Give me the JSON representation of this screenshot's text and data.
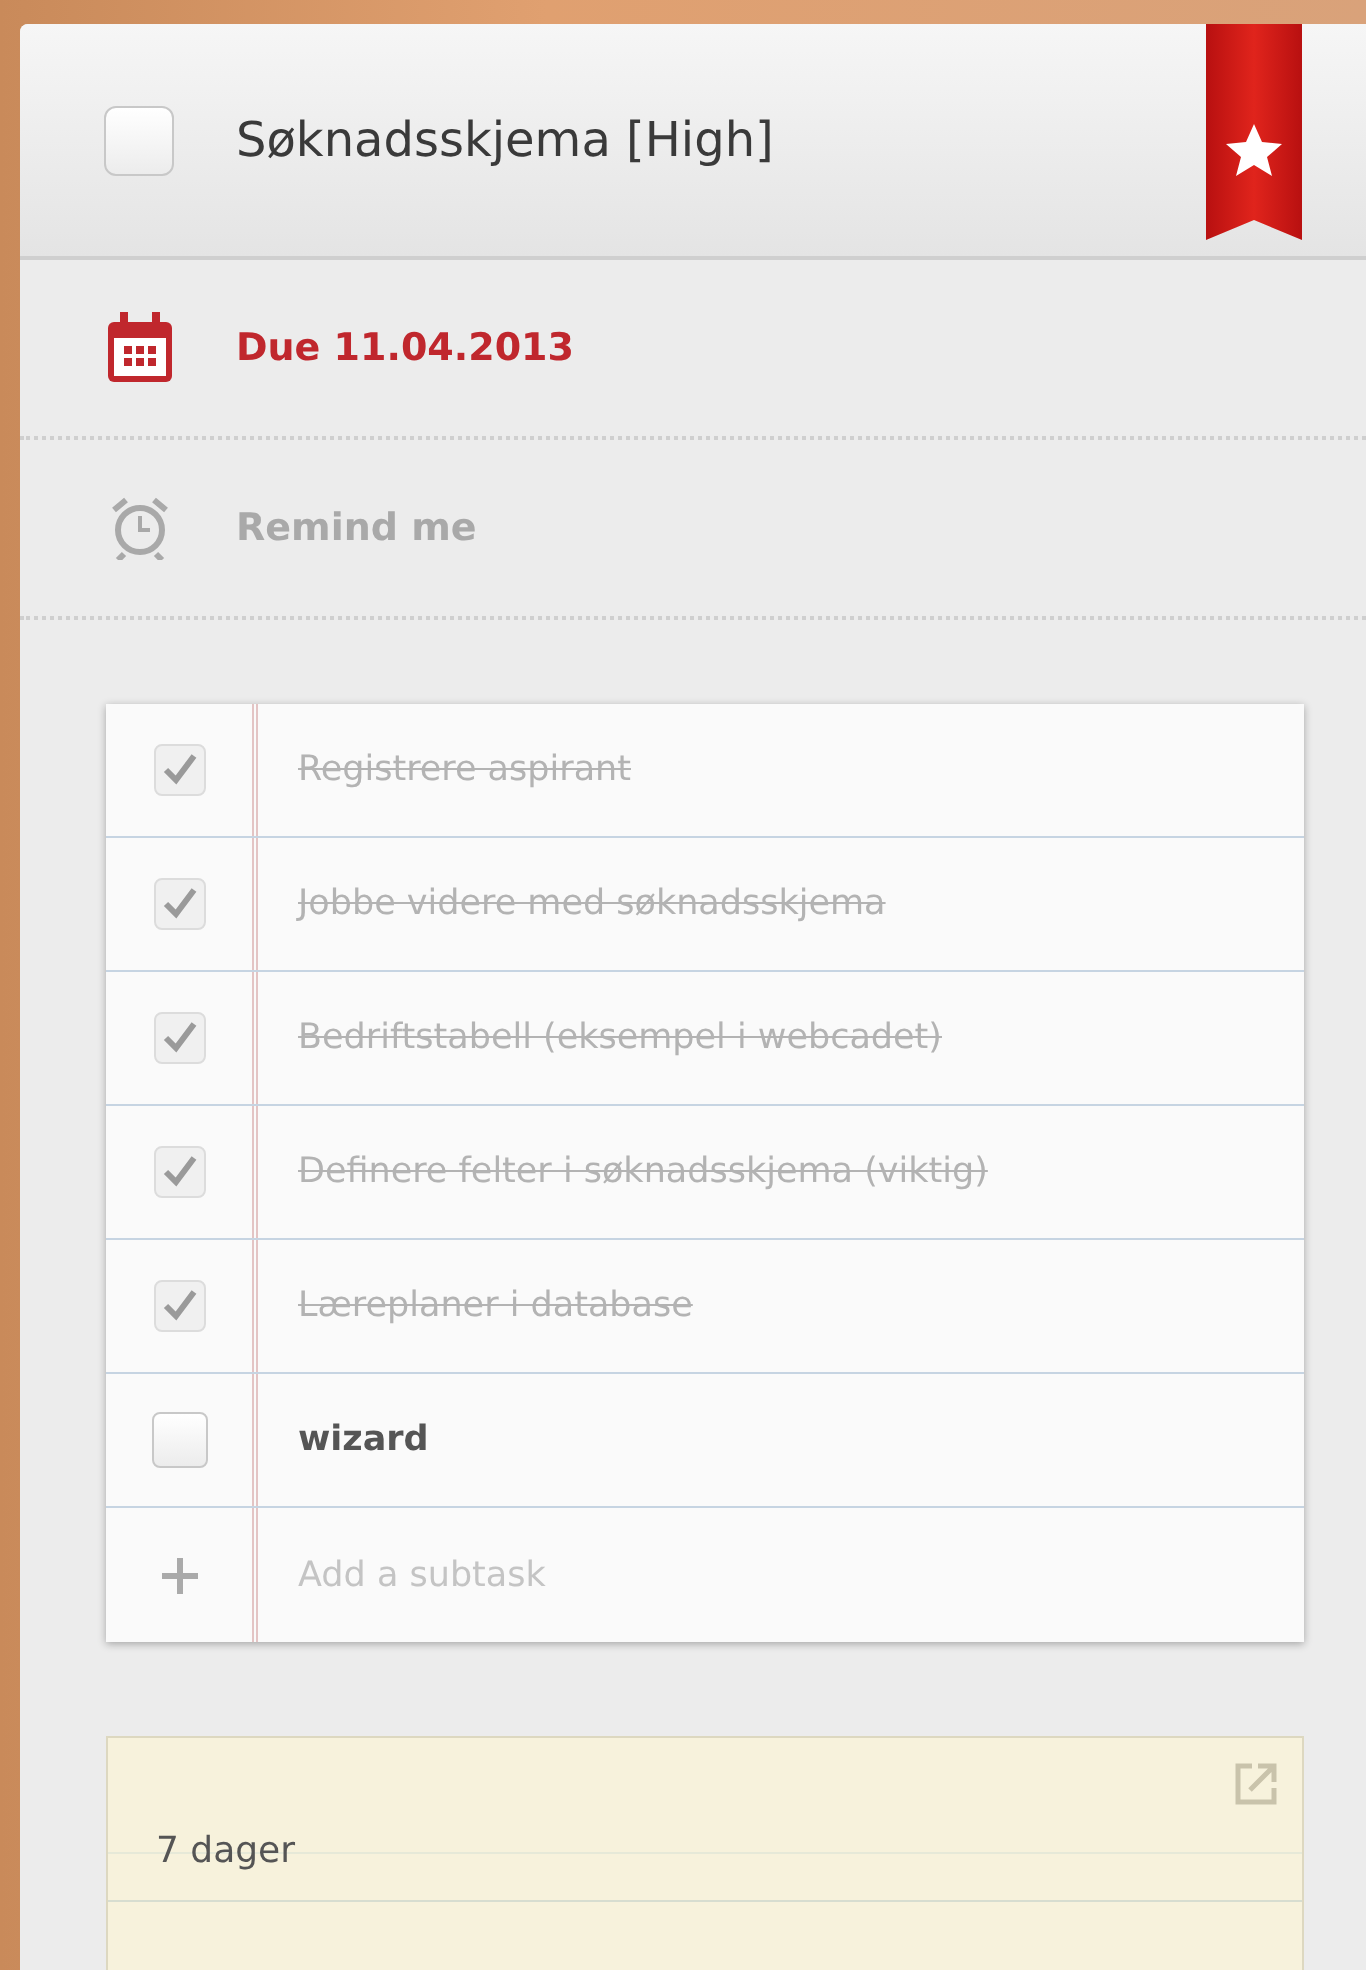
{
  "task": {
    "title": "Søknadsskjema [High]",
    "checked": false,
    "starred": true
  },
  "due": {
    "label": "Due 11.04.2013",
    "overdue": true
  },
  "reminder": {
    "label": "Remind me",
    "set": false
  },
  "subtasks": [
    {
      "text": "Registrere aspirant",
      "checked": true
    },
    {
      "text": "Jobbe videre med søknadsskjema",
      "checked": true
    },
    {
      "text": "Bedriftstabell (eksempel i webcadet)",
      "checked": true
    },
    {
      "text": "Definere felter i søknadsskjema (viktig)",
      "checked": true
    },
    {
      "text": "Læreplaner i database",
      "checked": true
    },
    {
      "text": "wizard",
      "checked": false
    }
  ],
  "add_subtask": {
    "placeholder": "Add a subtask"
  },
  "note": {
    "text": "7 dager"
  }
}
